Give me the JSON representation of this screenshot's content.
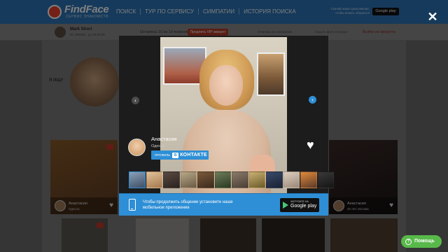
{
  "header": {
    "logo_title": "FindFace",
    "logo_subtitle": "сервис знакомств",
    "nav": [
      "ПОИСК",
      "ТУР ПО СЕРВИСУ",
      "СИМПАТИИ",
      "ИСТОРИЯ ПОИСКА"
    ],
    "app_promo": "Скачай наше приложение, чтобы искать общаться",
    "google_play_small": "Google play"
  },
  "userbar": {
    "name": "Mark Short",
    "meta": "ID: 000000 · до 00.00.00",
    "attempts": "Осталось 10 из 10 поисков",
    "vip_button": "Продлить VIP аккаунт",
    "stat_a": "Отвечаю на сообщения",
    "stat_b": "Скрыть фото в поиске",
    "logout": "Выйти из аккаунта"
  },
  "search": {
    "label": "Я ИЩУ"
  },
  "results": [
    {
      "name": "Анастасия",
      "city": "Одесса"
    },
    {
      "name": "Анастасия",
      "city": "20 лет, Москва"
    }
  ],
  "modal": {
    "close": "✕",
    "profile_name": "Анастасия",
    "profile_city": "Одесса",
    "vk_prefix": "ПРОФИЛЬ",
    "vk_logo": "В",
    "vk_brand": "КОНТАКТЕ",
    "heart": "♥",
    "prev_arrow": "‹",
    "next_arrow": "›",
    "thumbnails_count": 12,
    "active_thumbnail": 1
  },
  "app_banner": {
    "text": "Чтобы продолжить общение установите наше мобильное приложение",
    "gp_top": "ЗАГРУЗИТЕ НА",
    "gp_bottom": "Google play"
  },
  "help": {
    "label": "Помощь",
    "icon": "?"
  },
  "colors": {
    "header_blue": "#2d74b6",
    "accent_blue": "#2e8fd6",
    "vip_red": "#b33a2a",
    "help_green": "#58b94a"
  }
}
